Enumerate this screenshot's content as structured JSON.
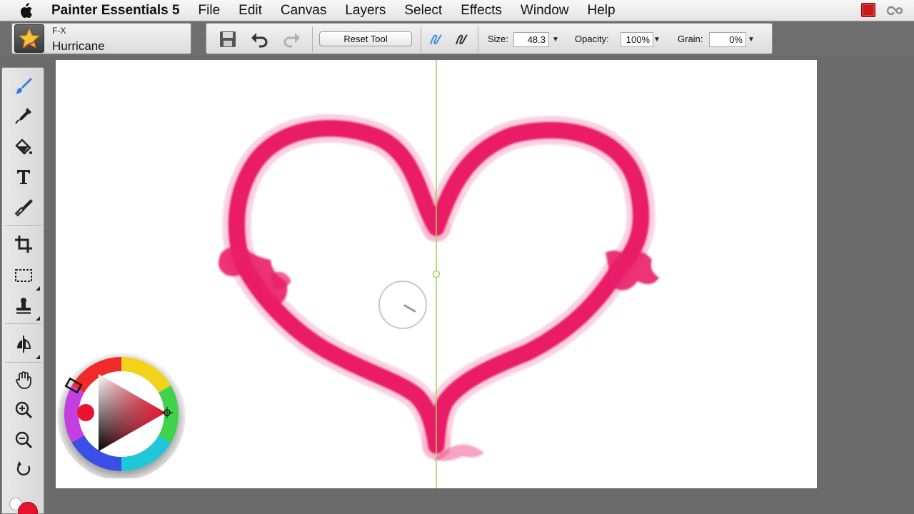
{
  "menubar": {
    "app_name": "Painter Essentials 5",
    "items": [
      "File",
      "Edit",
      "Canvas",
      "Layers",
      "Select",
      "Effects",
      "Window",
      "Help"
    ],
    "right_icons": [
      "record-icon",
      "creative-cloud-icon"
    ]
  },
  "brush": {
    "category": "F-X",
    "variant": "Hurricane"
  },
  "property_bar": {
    "reset_label": "Reset Tool",
    "size_label": "Size:",
    "size_value": "48.3",
    "opacity_label": "Opacity:",
    "opacity_value": "100%",
    "grain_label": "Grain:",
    "grain_value": "0%",
    "icons": [
      "save-icon",
      "undo-icon",
      "redo-icon",
      "stroke-attributes-icon",
      "stroke-smoothing-icon"
    ]
  },
  "toolbox": {
    "tools": [
      "brush-tool-icon",
      "dropper-tool-icon",
      "paint-bucket-icon",
      "text-tool-icon",
      "eraser-brush-icon",
      "crop-tool-icon",
      "rectangular-selection-icon",
      "clone-tool-icon",
      "mirror-tool-icon",
      "grabber-hand-icon",
      "zoom-in-icon",
      "zoom-out-icon",
      "rotate-page-icon"
    ]
  },
  "colors": {
    "main_color": "#e8142f",
    "secondary_color": "#ffffff",
    "stroke_color": "#ea1c67",
    "symmetry_line": "#9fd760"
  }
}
